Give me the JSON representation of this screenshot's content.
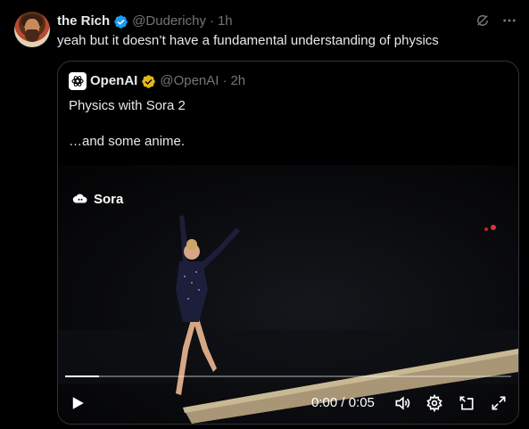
{
  "post": {
    "author_name": "the Rich",
    "handle": "@Duderichy",
    "separator": "·",
    "time": "1h",
    "text": "yeah but it doesn’t have a fundamental understanding of physics"
  },
  "quoted": {
    "author_name": "OpenAI",
    "handle": "@OpenAI",
    "separator": "·",
    "time": "2h",
    "text": "Physics with Sora 2\n\n…and some anime."
  },
  "video": {
    "badge_label": "Sora",
    "time_display": "0:00 / 0:05",
    "progress_fraction": 0.075
  },
  "colors": {
    "verified": "#1d9bf0",
    "verified_gold": "#e2b719",
    "muted": "#71767b"
  },
  "icons": [
    "grok-icon",
    "more-icon",
    "play-icon",
    "volume-icon",
    "settings-icon",
    "pip-icon",
    "fullscreen-icon"
  ]
}
